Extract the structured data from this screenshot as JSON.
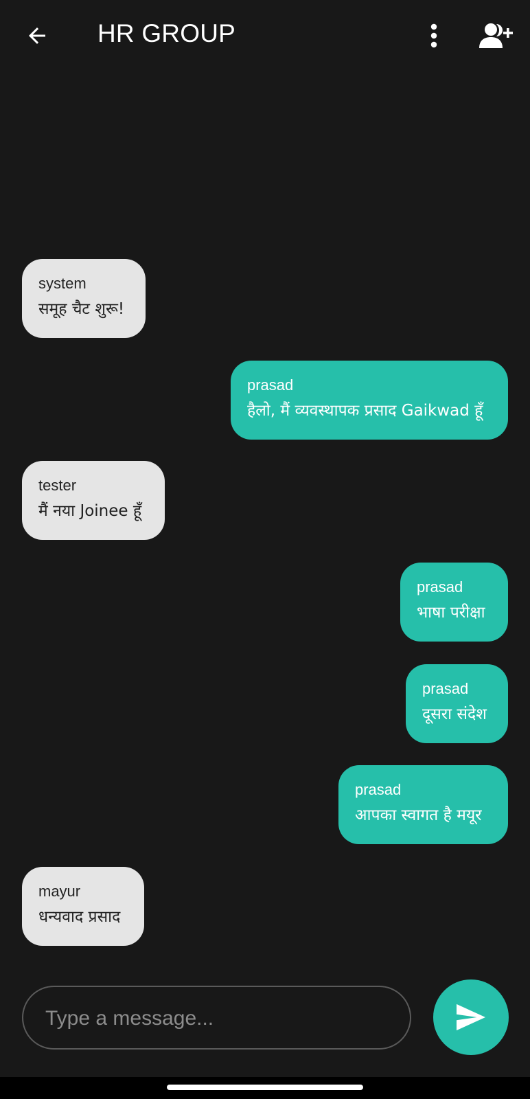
{
  "header": {
    "title": "HR GROUP",
    "back_icon": "arrow-back-icon",
    "menu_icon": "more-vertical-icon",
    "add_icon": "add-person-icon"
  },
  "messages": [
    {
      "sender": "system",
      "text": "समूह चैट शुरू!",
      "direction": "incoming"
    },
    {
      "sender": "prasad",
      "text": "हैलो, मैं व्यवस्थापक प्रसाद Gaikwad हूँ",
      "direction": "outgoing"
    },
    {
      "sender": "tester",
      "text": "मैं नया Joinee हूँ",
      "direction": "incoming"
    },
    {
      "sender": "prasad",
      "text": "भाषा परीक्षा",
      "direction": "outgoing"
    },
    {
      "sender": "prasad",
      "text": "दूसरा संदेश",
      "direction": "outgoing"
    },
    {
      "sender": "prasad",
      "text": "आपका स्वागत है मयूर",
      "direction": "outgoing"
    },
    {
      "sender": "mayur",
      "text": "धन्यवाद प्रसाद",
      "direction": "incoming"
    }
  ],
  "composer": {
    "placeholder": "Type a message...",
    "value": "",
    "send_icon": "send-icon"
  },
  "colors": {
    "background": "#181818",
    "incoming_bubble": "#e5e5e5",
    "outgoing_bubble": "#26bfaa",
    "accent": "#26bfaa"
  }
}
